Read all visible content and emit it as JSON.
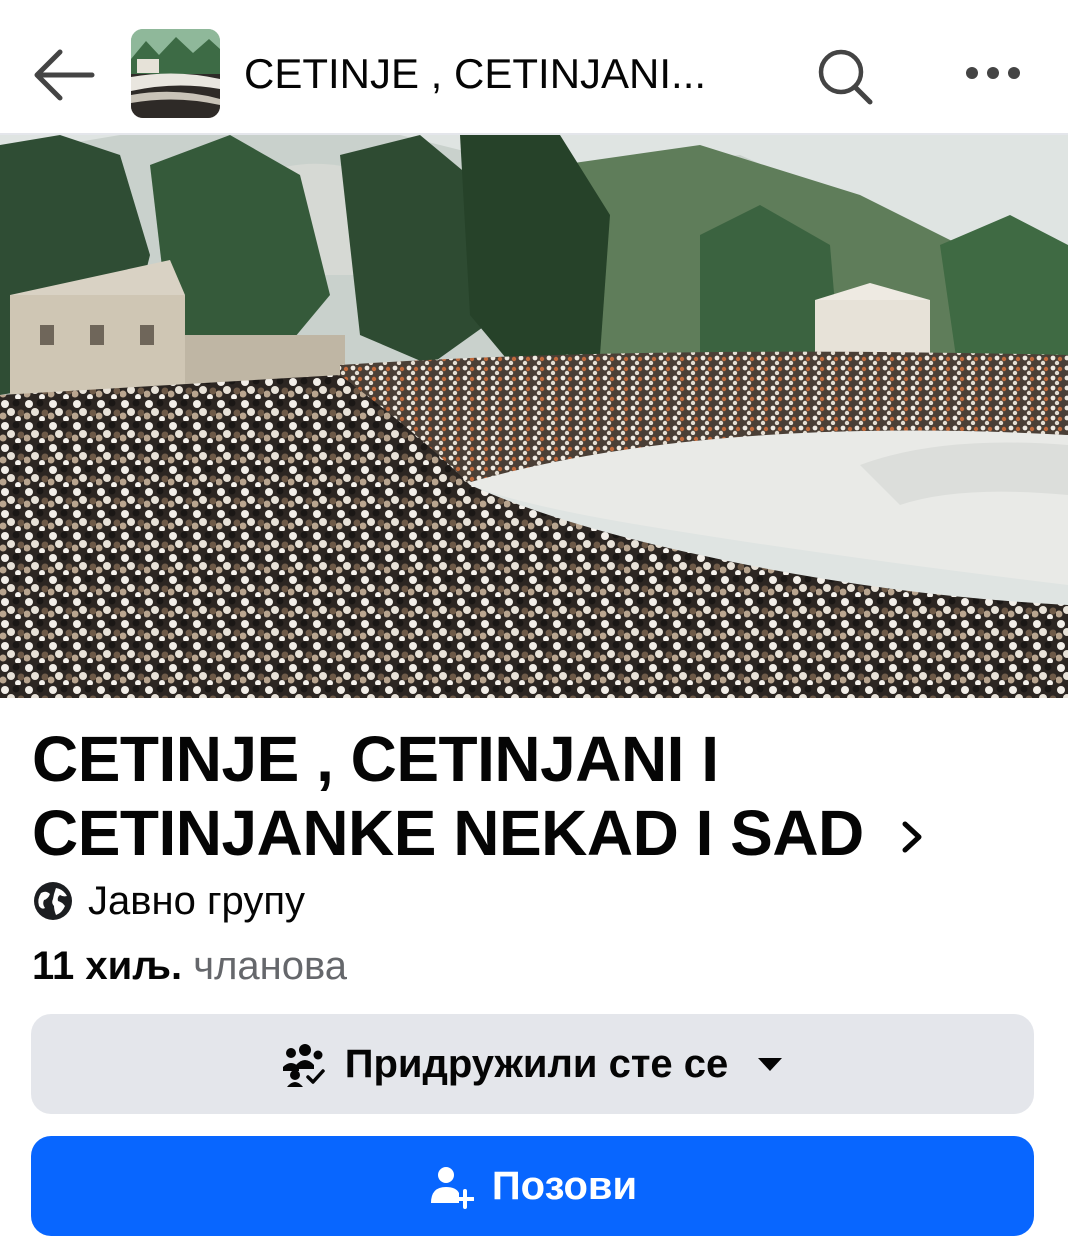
{
  "header": {
    "title": "CETINJE , CETINJANI...",
    "back_icon": "arrow-left-icon",
    "search_icon": "search-icon",
    "more_icon": "more-dots-icon"
  },
  "group": {
    "name": "CETINJE , CETINJANI  I\nCETINJANKE  NEKAD I SAD",
    "privacy": "Јавно групу",
    "members_count": "11 хиљ.",
    "members_label": "чланова"
  },
  "buttons": {
    "joined_label": "Придружили сте се",
    "invite_label": "Позови"
  },
  "colors": {
    "primary": "#0866ff",
    "secondary_bg": "#e4e6eb",
    "muted_text": "#65676b"
  }
}
